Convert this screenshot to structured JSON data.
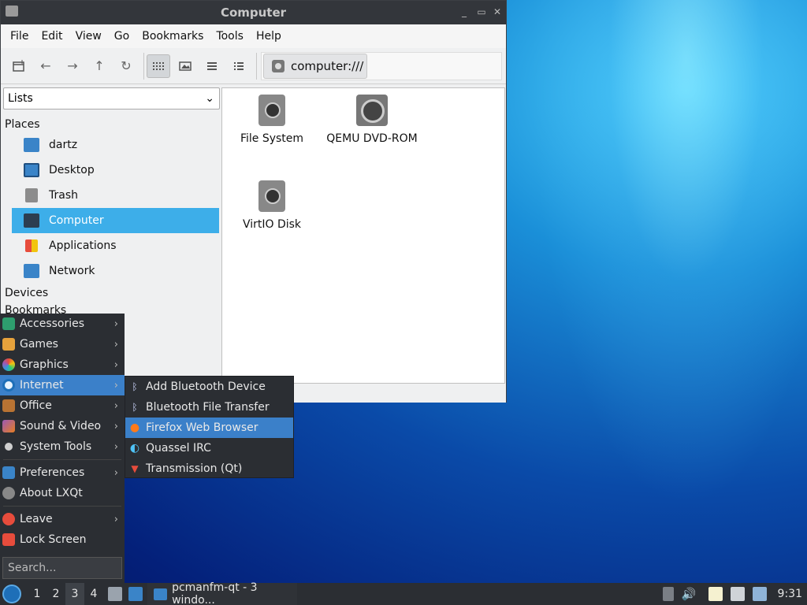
{
  "window": {
    "title": "Computer",
    "controls": [
      "_",
      "▭",
      "✕"
    ],
    "menu": [
      "File",
      "Edit",
      "View",
      "Go",
      "Bookmarks",
      "Tools",
      "Help"
    ],
    "path": "computer:///",
    "sidebar_mode": "Lists",
    "places_header": "Places",
    "places": [
      {
        "label": "dartz",
        "icon": "home-folder-icon",
        "color": "#3a84c8"
      },
      {
        "label": "Desktop",
        "icon": "desktop-icon",
        "color": "#3a84c8"
      },
      {
        "label": "Trash",
        "icon": "trash-icon",
        "color": "#8c8c8c"
      },
      {
        "label": "Computer",
        "icon": "computer-icon",
        "color": "#2c3e50",
        "selected": true
      },
      {
        "label": "Applications",
        "icon": "applications-icon",
        "color": "#e74c3c"
      },
      {
        "label": "Network",
        "icon": "network-folder-icon",
        "color": "#3a84c8"
      }
    ],
    "devices_header": "Devices",
    "bookmarks_header": "Bookmarks",
    "files": [
      {
        "label": "File System",
        "type": "disk"
      },
      {
        "label": "QEMU DVD-ROM",
        "type": "rom"
      },
      {
        "label": "VirtIO Disk",
        "type": "disk"
      }
    ]
  },
  "start_menu": {
    "items": [
      {
        "label": "Accessories",
        "icon": "accessories-icon",
        "color": "#2e9e6e",
        "arrow": true
      },
      {
        "label": "Games",
        "icon": "games-icon",
        "color": "#e6a23c",
        "arrow": true
      },
      {
        "label": "Graphics",
        "icon": "graphics-icon",
        "color": "#d9534f",
        "arrow": true
      },
      {
        "label": "Internet",
        "icon": "internet-icon",
        "color": "#5bc0de",
        "arrow": true,
        "highlight": true
      },
      {
        "label": "Office",
        "icon": "office-icon",
        "color": "#b87333",
        "arrow": true
      },
      {
        "label": "Sound & Video",
        "icon": "sound-video-icon",
        "color": "#9b59b6",
        "arrow": true
      },
      {
        "label": "System Tools",
        "icon": "system-tools-icon",
        "color": "#cfcfcf",
        "arrow": true
      }
    ],
    "items2": [
      {
        "label": "Preferences",
        "icon": "preferences-icon",
        "color": "#3a84c8",
        "arrow": true
      },
      {
        "label": "About LXQt",
        "icon": "info-icon",
        "color": "#888888",
        "arrow": false
      }
    ],
    "items3": [
      {
        "label": "Leave",
        "icon": "power-icon",
        "color": "#e74c3c",
        "arrow": true
      },
      {
        "label": "Lock Screen",
        "icon": "lock-icon",
        "color": "#e74c3c",
        "arrow": false
      }
    ],
    "search_placeholder": "Search..."
  },
  "internet_submenu": [
    {
      "label": "Add Bluetooth Device",
      "icon": "bluetooth-icon",
      "glyph": "ᛒ"
    },
    {
      "label": "Bluetooth File Transfer",
      "icon": "bluetooth-icon",
      "glyph": "ᛒ"
    },
    {
      "label": "Firefox Web Browser",
      "icon": "firefox-icon",
      "glyph": "●",
      "highlight": true
    },
    {
      "label": "Quassel IRC",
      "icon": "quassel-icon",
      "glyph": "◐"
    },
    {
      "label": "Transmission (Qt)",
      "icon": "transmission-icon",
      "glyph": "▼"
    }
  ],
  "taskbar": {
    "workspaces": [
      "1",
      "2",
      "3",
      "4"
    ],
    "current_workspace": "3",
    "task_label": "pcmanfm-qt - 3 windo...",
    "clock": "9:31"
  }
}
